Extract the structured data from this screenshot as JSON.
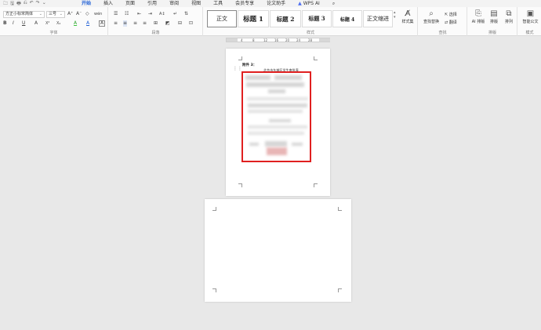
{
  "quick_access": [
    "🗀",
    "🖫",
    "🖶",
    "⎌",
    "↶",
    "↷",
    "⌄"
  ],
  "tabs": [
    {
      "label": "开始",
      "active": true
    },
    {
      "label": "插入"
    },
    {
      "label": "页面"
    },
    {
      "label": "引用"
    },
    {
      "label": "审阅"
    },
    {
      "label": "视图"
    },
    {
      "label": "工具"
    },
    {
      "label": "会员专享"
    },
    {
      "label": "论文助手"
    },
    {
      "label": "WPS AI"
    }
  ],
  "font": {
    "name": "方正小标宋简体",
    "size": "三号",
    "group_label": "字体",
    "row1_tools": [
      "A⁺",
      "A⁻",
      "◇",
      "wén"
    ],
    "row2_tools": [
      "B",
      "I",
      "U",
      "A",
      "X²",
      "X₂",
      "A",
      "A",
      "A"
    ]
  },
  "paragraph": {
    "group_label": "段落",
    "row1_tools": [
      "☰",
      "☷",
      "⇤",
      "⇥",
      "A↕",
      "↵",
      "⇅"
    ],
    "row2_tools": [
      "≡",
      "≡",
      "≡",
      "≡",
      "⊞",
      "◩",
      "⊟",
      "⊡"
    ]
  },
  "styles": {
    "group_label": "样式",
    "items": [
      "正文",
      "标题 1",
      "标题 2",
      "标题 3",
      "标题 4",
      "正文缩进"
    ],
    "styles_set": "样式集"
  },
  "find": {
    "group_label": "查找",
    "find_replace": "查找替换",
    "select": "选择",
    "translate": "翻译"
  },
  "layout": {
    "group_label": "排版",
    "ai_layout": "AI 排版",
    "layout": "排版",
    "arrange": "排列"
  },
  "format": {
    "group_label": "模式",
    "smart": "智能公文"
  },
  "ruler": [
    "4",
    "8",
    "12",
    "16",
    "20",
    "24",
    "28"
  ],
  "document": {
    "label": "附件 3：",
    "title": "北京市东城区学生审批表"
  },
  "colors": {
    "accent": "#1f5fd6",
    "highlight_box": "#e02020"
  }
}
